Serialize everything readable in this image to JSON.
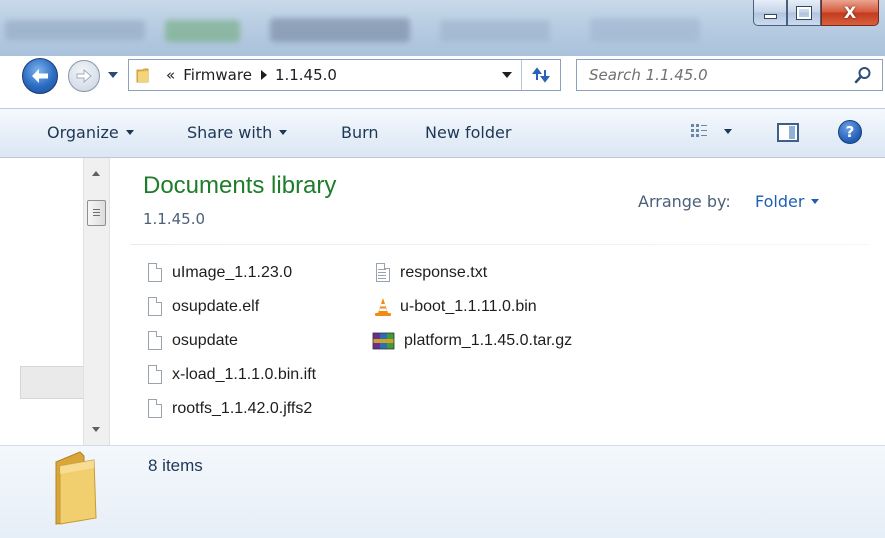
{
  "window": {
    "minimize_symbol": "—",
    "close_symbol": "X"
  },
  "address": {
    "overflow": "«",
    "crumbs": [
      "Firmware",
      "1.1.45.0"
    ]
  },
  "search": {
    "placeholder": "Search 1.1.45.0"
  },
  "toolbar": {
    "organize": "Organize",
    "share_with": "Share with",
    "burn": "Burn",
    "new_folder": "New folder",
    "help": "?"
  },
  "library": {
    "title": "Documents library",
    "subtitle": "1.1.45.0",
    "arrange_label": "Arrange by:",
    "arrange_value": "Folder"
  },
  "files": [
    {
      "name": "uImage_1.1.23.0",
      "icon": "blank-file-icon"
    },
    {
      "name": "osupdate.elf",
      "icon": "blank-file-icon"
    },
    {
      "name": "osupdate",
      "icon": "blank-file-icon"
    },
    {
      "name": "x-load_1.1.1.0.bin.ift",
      "icon": "blank-file-icon"
    },
    {
      "name": "rootfs_1.1.42.0.jffs2",
      "icon": "blank-file-icon"
    },
    {
      "name": "response.txt",
      "icon": "text-file-icon"
    },
    {
      "name": "u-boot_1.1.11.0.bin",
      "icon": "vlc-cone-icon"
    },
    {
      "name": "platform_1.1.45.0.tar.gz",
      "icon": "winrar-archive-icon"
    }
  ],
  "status": {
    "item_count": "8 items"
  },
  "colors": {
    "library_title": "#1e7d2a",
    "link_blue": "#1e5fb4",
    "toolbar_text": "#1e3757"
  }
}
